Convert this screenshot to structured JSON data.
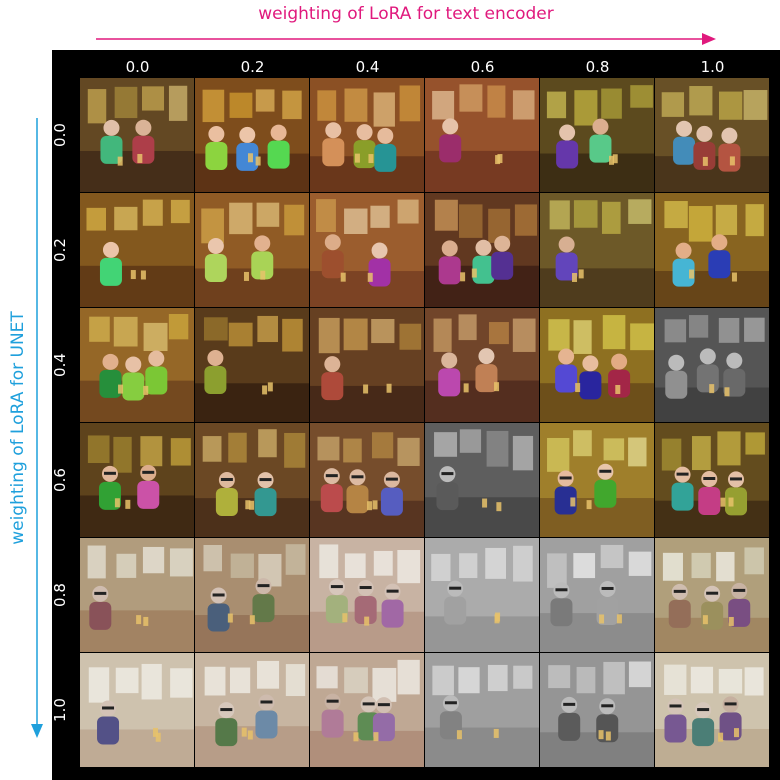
{
  "x_axis": {
    "label": "weighting of LoRA for text encoder",
    "color": "#e0197d",
    "ticks": [
      "0.0",
      "0.2",
      "0.4",
      "0.6",
      "0.8",
      "1.0"
    ]
  },
  "y_axis": {
    "label": "weighting of LoRA for UNET",
    "color": "#1fa0dc",
    "ticks": [
      "0.0",
      "0.2",
      "0.4",
      "0.6",
      "0.8",
      "1.0"
    ]
  },
  "grid": {
    "rows": 6,
    "cols": 6
  }
}
